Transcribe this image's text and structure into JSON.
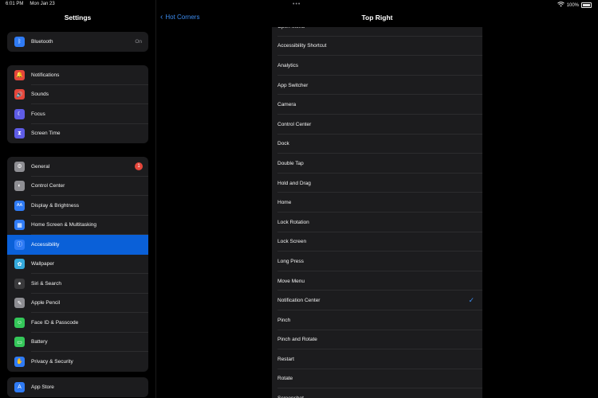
{
  "status": {
    "time": "6:01 PM",
    "date": "Mon Jan 23",
    "battery": "100%",
    "wifi_icon": "wifi-icon"
  },
  "sidebar": {
    "title": "Settings",
    "group1": [
      {
        "label": "Bluetooth",
        "value": "On",
        "icon": "bluetooth-icon",
        "color": "#2f7bf5"
      }
    ],
    "group2": [
      {
        "label": "Notifications",
        "icon": "bell-icon",
        "color": "#e5463b"
      },
      {
        "label": "Sounds",
        "icon": "speaker-icon",
        "color": "#e5463b"
      },
      {
        "label": "Focus",
        "icon": "moon-icon",
        "color": "#5e5ce6"
      },
      {
        "label": "Screen Time",
        "icon": "hourglass-icon",
        "color": "#5e5ce6"
      }
    ],
    "group3": [
      {
        "label": "General",
        "icon": "gear-icon",
        "color": "#8e8e93",
        "badge": "1"
      },
      {
        "label": "Control Center",
        "icon": "switches-icon",
        "color": "#8e8e93"
      },
      {
        "label": "Display & Brightness",
        "icon": "text-size-icon",
        "color": "#2f7bf5"
      },
      {
        "label": "Home Screen & Multitasking",
        "icon": "grid-icon",
        "color": "#2f7bf5"
      },
      {
        "label": "Accessibility",
        "icon": "accessibility-icon",
        "color": "#2f7bf5",
        "selected": true
      },
      {
        "label": "Wallpaper",
        "icon": "flower-icon",
        "color": "#34aadc"
      },
      {
        "label": "Siri & Search",
        "icon": "siri-icon",
        "color": "#3a3a3c"
      },
      {
        "label": "Apple Pencil",
        "icon": "pencil-icon",
        "color": "#8e8e93"
      },
      {
        "label": "Face ID & Passcode",
        "icon": "face-id-icon",
        "color": "#34c759"
      },
      {
        "label": "Battery",
        "icon": "battery-icon",
        "color": "#34c759"
      },
      {
        "label": "Privacy & Security",
        "icon": "hand-icon",
        "color": "#2f7bf5"
      }
    ],
    "group4": [
      {
        "label": "App Store",
        "icon": "app-store-icon",
        "color": "#2f7bf5"
      }
    ]
  },
  "pane": {
    "back_label": "Hot Corners",
    "title": "Top Right",
    "items": [
      {
        "label": "Open Menu"
      },
      {
        "label": "Accessibility Shortcut"
      },
      {
        "label": "Analytics"
      },
      {
        "label": "App Switcher"
      },
      {
        "label": "Camera"
      },
      {
        "label": "Control Center"
      },
      {
        "label": "Dock"
      },
      {
        "label": "Double Tap"
      },
      {
        "label": "Hold and Drag"
      },
      {
        "label": "Home"
      },
      {
        "label": "Lock Rotation"
      },
      {
        "label": "Lock Screen"
      },
      {
        "label": "Long Press"
      },
      {
        "label": "Move Menu"
      },
      {
        "label": "Notification Center",
        "checked": true
      },
      {
        "label": "Pinch"
      },
      {
        "label": "Pinch and Rotate"
      },
      {
        "label": "Restart"
      },
      {
        "label": "Rotate"
      },
      {
        "label": "Screenshot"
      }
    ]
  }
}
